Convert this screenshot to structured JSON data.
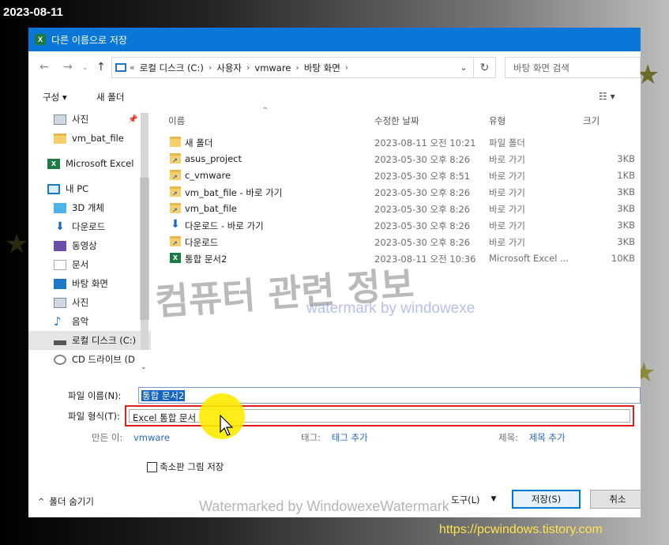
{
  "date_stamp": "2023-08-11",
  "site_url": "https://pcwindows.tistory.com",
  "watermarks": {
    "main": "컴퓨터 관련 정보",
    "small": "watermark by windowexe",
    "bottom": "Watermarked by WindowexeWatermark"
  },
  "dialog": {
    "title": "다른 이름으로 저장",
    "app_icon": "excel-icon",
    "address": {
      "prefix": "«",
      "crumbs": [
        "로컬 디스크 (C:)",
        "사용자",
        "vmware",
        "바탕 화면"
      ]
    },
    "search_placeholder": "바탕 화면 검색",
    "toolbar": {
      "organize": "구성 ▾",
      "new_folder": "새 폴더"
    },
    "nav": {
      "items": [
        {
          "label": "사진",
          "icon": "pictures-icon"
        },
        {
          "label": "vm_bat_file",
          "icon": "folder-icon"
        },
        {
          "label": "Microsoft Excel",
          "icon": "excel-icon"
        },
        {
          "label": "내 PC",
          "icon": "pc-icon"
        },
        {
          "label": "3D 개체",
          "icon": "3d-objects-icon"
        },
        {
          "label": "다운로드",
          "icon": "download-icon"
        },
        {
          "label": "동영상",
          "icon": "video-icon"
        },
        {
          "label": "문서",
          "icon": "documents-icon"
        },
        {
          "label": "바탕 화면",
          "icon": "desktop-icon"
        },
        {
          "label": "사진",
          "icon": "pictures-icon"
        },
        {
          "label": "음악",
          "icon": "music-icon"
        },
        {
          "label": "로컬 디스크 (C:)",
          "icon": "drive-icon"
        },
        {
          "label": "CD 드라이브 (D",
          "icon": "cd-drive-icon"
        }
      ]
    },
    "columns": {
      "name": "이름",
      "date": "수정한 날짜",
      "type": "유형",
      "size": "크기"
    },
    "files": [
      {
        "name": "새 폴더",
        "date": "2023-08-11 오전 10:21",
        "type": "파일 폴더",
        "size": "",
        "icon": "folder-icon"
      },
      {
        "name": "asus_project",
        "date": "2023-05-30 오후 8:26",
        "type": "바로 가기",
        "size": "3KB",
        "icon": "shortcut-icon"
      },
      {
        "name": "c_vmware",
        "date": "2023-05-30 오후 8:51",
        "type": "바로 가기",
        "size": "1KB",
        "icon": "shortcut-icon"
      },
      {
        "name": "vm_bat_file - 바로 가기",
        "date": "2023-05-30 오후 8:26",
        "type": "바로 가기",
        "size": "3KB",
        "icon": "shortcut-icon"
      },
      {
        "name": "vm_bat_file",
        "date": "2023-05-30 오후 8:26",
        "type": "바로 가기",
        "size": "3KB",
        "icon": "shortcut-icon"
      },
      {
        "name": "다운로드 - 바로 가기",
        "date": "2023-05-30 오후 8:26",
        "type": "바로 가기",
        "size": "3KB",
        "icon": "download-shortcut-icon"
      },
      {
        "name": "다운로드",
        "date": "2023-05-30 오후 8:26",
        "type": "바로 가기",
        "size": "3KB",
        "icon": "shortcut-icon"
      },
      {
        "name": "통합 문서2",
        "date": "2023-08-11 오전 10:36",
        "type": "Microsoft Excel ...",
        "size": "10KB",
        "icon": "excel-file-icon"
      }
    ],
    "filename_label": "파일 이름(N):",
    "filename_value": "통합 문서2",
    "filetype_label": "파일 형식(T):",
    "filetype_value": "Excel 통합 문서",
    "authors_label": "만든 이:",
    "authors_value": "vmware",
    "tags_label": "태그:",
    "tags_value": "태그 추가",
    "title_label": "제목:",
    "title_value": "제목 추가",
    "thumbnail_label": "축소판 그림 저장",
    "hide_folders": "폴더 숨기기",
    "tools_label": "도구(L)",
    "save_label": "저장(S)",
    "cancel_label": "취소"
  }
}
